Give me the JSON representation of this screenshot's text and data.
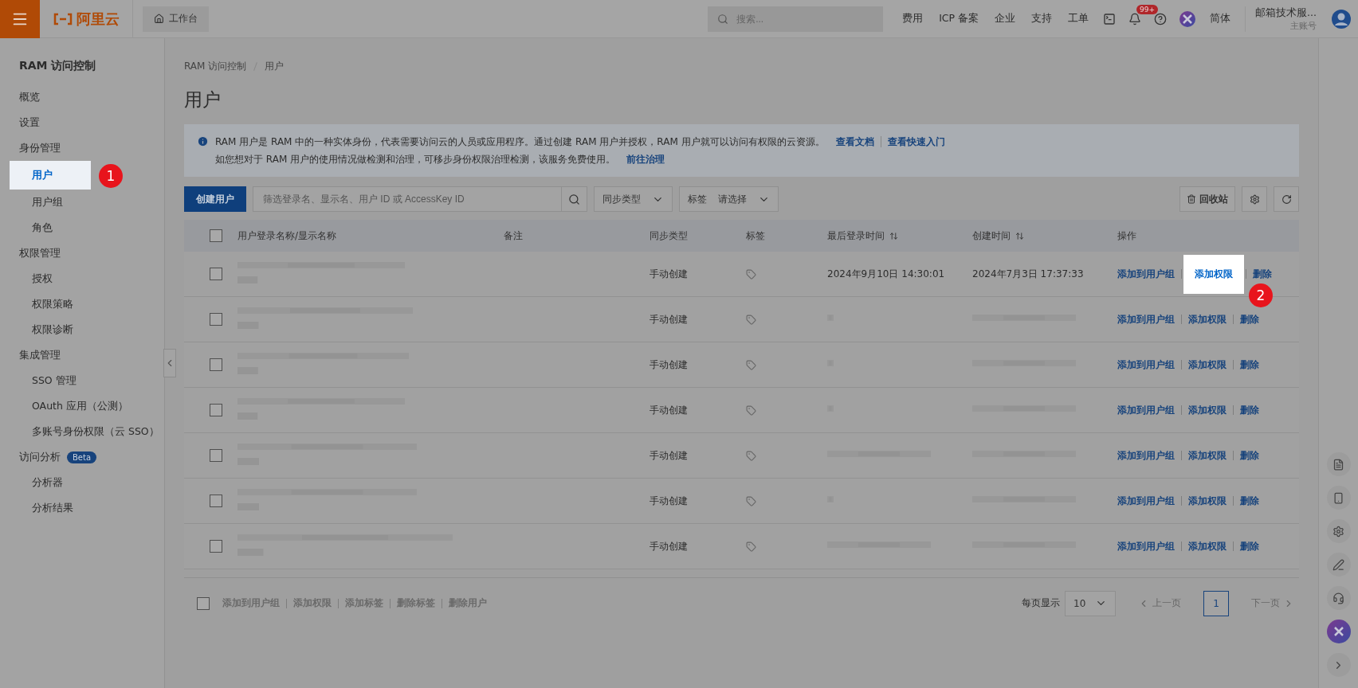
{
  "topbar": {
    "logo": "阿里云",
    "workbench": "工作台",
    "search": {
      "placeholder": "搜索..."
    },
    "menu": [
      "费用",
      "ICP 备案",
      "企业",
      "支持",
      "工单"
    ],
    "notification_badge": "99+",
    "language": "简体",
    "account": {
      "name": "邮箱技术服...",
      "role": "主账号"
    }
  },
  "sidebar": {
    "title": "RAM 访问控制",
    "items": [
      {
        "label": "概览",
        "selected": false
      },
      {
        "label": "设置",
        "selected": false
      },
      {
        "label": "身份管理",
        "children": [
          {
            "label": "用户",
            "selected": true,
            "step": "1"
          },
          {
            "label": "用户组",
            "selected": false
          },
          {
            "label": "角色",
            "selected": false
          }
        ]
      },
      {
        "label": "权限管理",
        "children": [
          {
            "label": "授权",
            "selected": false
          },
          {
            "label": "权限策略",
            "selected": false
          },
          {
            "label": "权限诊断",
            "selected": false
          }
        ]
      },
      {
        "label": "集成管理",
        "children": [
          {
            "label": "SSO 管理",
            "selected": false
          },
          {
            "label": "OAuth 应用（公测）",
            "selected": false
          },
          {
            "label": "多账号身份权限（云 SSO）",
            "selected": false
          }
        ]
      },
      {
        "label": "访问分析",
        "badge": "Beta",
        "children": [
          {
            "label": "分析器",
            "selected": false
          },
          {
            "label": "分析结果",
            "selected": false
          }
        ]
      }
    ]
  },
  "breadcrumb": [
    "RAM 访问控制",
    "用户"
  ],
  "title": "用户",
  "notice": {
    "lines": [
      {
        "text": "RAM 用户是 RAM 中的一种实体身份，代表需要访问云的人员或应用程序。通过创建 RAM 用户并授权，RAM 用户就可以访问有权限的云资源。",
        "links": [
          "查看文档",
          "查看快速入门"
        ]
      },
      {
        "text": "如您想对于 RAM 用户的使用情况做检测和治理，可移步身份权限治理检测，该服务免费使用。",
        "links": [
          "前往治理"
        ]
      }
    ]
  },
  "toolbar": {
    "create_button": "创建用户",
    "search": {
      "placeholder": "筛选登录名、显示名、用户 ID 或 AccessKey ID"
    },
    "sync_filter": "同步类型",
    "tag_filter": {
      "label": "标签",
      "placeholder": "请选择"
    },
    "recycle_button": "回收站"
  },
  "table": {
    "select_all_checked": false,
    "columns": [
      {
        "label": "用户登录名称/显示名称",
        "sortable": false
      },
      {
        "label": "备注",
        "sortable": false
      },
      {
        "label": "同步类型",
        "sortable": false
      },
      {
        "label": "标签",
        "sortable": false
      },
      {
        "label": "最后登录时间",
        "sortable": true
      },
      {
        "label": "创建时间",
        "sortable": true
      },
      {
        "label": "操作",
        "sortable": false
      }
    ],
    "rows": [
      {
        "checked": false,
        "sync": "手动创建",
        "last_login": "2024年9月10日 14:30:01",
        "created": "2024年7月3日 17:37:33",
        "actions": [
          {
            "label": "添加到用户组",
            "highlighted": false
          },
          {
            "label": "添加权限",
            "highlighted": true,
            "step": "2"
          },
          {
            "label": "删除",
            "highlighted": false
          }
        ]
      },
      {
        "checked": false,
        "sync": "手动创建",
        "actions": [
          {
            "label": "添加到用户组",
            "highlighted": false
          },
          {
            "label": "添加权限",
            "highlighted": false
          },
          {
            "label": "删除",
            "highlighted": false
          }
        ]
      },
      {
        "checked": false,
        "sync": "手动创建",
        "actions": [
          {
            "label": "添加到用户组",
            "highlighted": false
          },
          {
            "label": "添加权限",
            "highlighted": false
          },
          {
            "label": "删除",
            "highlighted": false
          }
        ]
      },
      {
        "checked": false,
        "sync": "手动创建",
        "actions": [
          {
            "label": "添加到用户组",
            "highlighted": false
          },
          {
            "label": "添加权限",
            "highlighted": false
          },
          {
            "label": "删除",
            "highlighted": false
          }
        ]
      },
      {
        "checked": false,
        "sync": "手动创建",
        "actions": [
          {
            "label": "添加到用户组",
            "highlighted": false
          },
          {
            "label": "添加权限",
            "highlighted": false
          },
          {
            "label": "删除",
            "highlighted": false
          }
        ]
      },
      {
        "checked": false,
        "sync": "手动创建",
        "actions": [
          {
            "label": "添加到用户组",
            "highlighted": false
          },
          {
            "label": "添加权限",
            "highlighted": false
          },
          {
            "label": "删除",
            "highlighted": false
          }
        ]
      },
      {
        "checked": false,
        "sync": "手动创建",
        "actions": [
          {
            "label": "添加到用户组",
            "highlighted": false
          },
          {
            "label": "添加权限",
            "highlighted": false
          },
          {
            "label": "删除",
            "highlighted": false
          }
        ]
      }
    ]
  },
  "footer": {
    "select_all_checked": false,
    "bulk_actions": [
      {
        "label": "添加到用户组",
        "disabled": true
      },
      {
        "label": "添加权限",
        "disabled": true
      },
      {
        "label": "添加标签",
        "disabled": true
      },
      {
        "label": "删除标签",
        "disabled": true
      },
      {
        "label": "删除用户",
        "disabled": true
      }
    ],
    "page_size_label": "每页显示",
    "page_size": "10",
    "prev": "上一页",
    "pages": [
      {
        "label": "1",
        "selected": true
      }
    ],
    "next": "下一页"
  }
}
